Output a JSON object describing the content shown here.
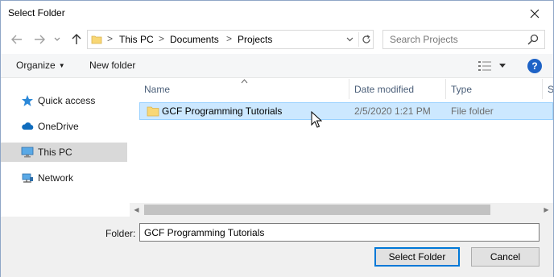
{
  "window": {
    "title": "Select Folder"
  },
  "address": {
    "crumbs": [
      "This PC",
      "Documents",
      "Projects"
    ],
    "separator": ">"
  },
  "search": {
    "placeholder": "Search Projects"
  },
  "toolbar": {
    "organize_label": "Organize",
    "new_folder_label": "New folder",
    "help_label": "?"
  },
  "nav": {
    "items": [
      {
        "label": "Quick access",
        "icon": "star-icon"
      },
      {
        "label": "OneDrive",
        "icon": "cloud-icon"
      },
      {
        "label": "This PC",
        "icon": "computer-icon",
        "selected": true
      },
      {
        "label": "Network",
        "icon": "network-icon"
      }
    ]
  },
  "columns": [
    "Name",
    "Date modified",
    "Type",
    "Si"
  ],
  "files": [
    {
      "name": "GCF Programming Tutorials",
      "date": "2/5/2020 1:21 PM",
      "type": "File folder"
    }
  ],
  "folder_field": {
    "label": "Folder:",
    "value": "GCF Programming Tutorials"
  },
  "buttons": {
    "select": "Select Folder",
    "cancel": "Cancel"
  },
  "colors": {
    "selection": "#cce8ff",
    "selection_border": "#99d1ff",
    "accent": "#0078d7",
    "folder": "#f8d775"
  }
}
